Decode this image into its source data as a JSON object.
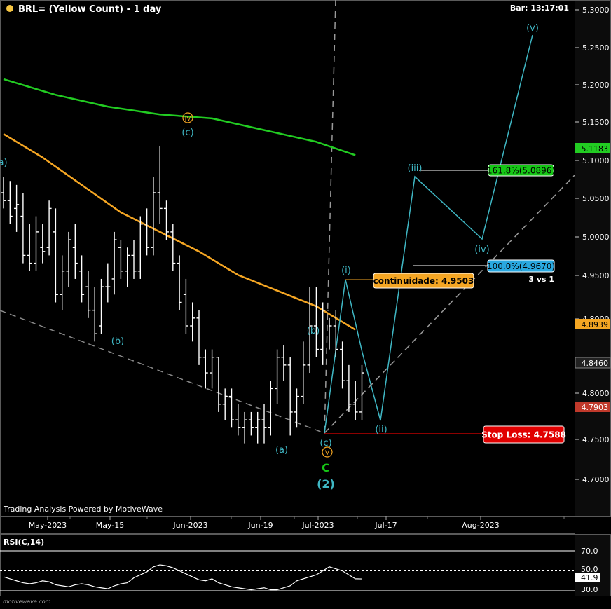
{
  "header": {
    "title": "BRL= (Yellow Count) - 1 day",
    "bar_time": "Bar: 13:17:01",
    "status_dot_color": "#f5c542"
  },
  "footer": {
    "credit": "Trading Analysis Powered by MotiveWave",
    "watermark": "motivewave.com"
  },
  "colors": {
    "ma_green": "#22cc22",
    "ma_orange": "#f5a623",
    "wave_cyan": "#3fb7c4",
    "bars": "#ffffff",
    "stop_loss": "#e00000",
    "fib_100": "#29a8e0",
    "fib_161": "#16c716",
    "continuidade": "#f5a623"
  },
  "chart_data": [
    {
      "type": "candlestick-ohlc",
      "title": "BRL= (Yellow Count) - 1 day",
      "x_tick_labels": [
        "May-2023",
        "May-15",
        "Jun-2023",
        "Jun-19",
        "Jul-2023",
        "Jul-17",
        "Aug-2023"
      ],
      "y_tick_labels": [
        "5.3000",
        "5.2500",
        "5.2000",
        "5.1500",
        "5.1000",
        "5.0500",
        "5.0000",
        "4.9500",
        "4.8000",
        "4.8460",
        "4.8000",
        "4.7500",
        "4.7000"
      ],
      "ylim": [
        4.65,
        5.32
      ],
      "price_tags": [
        {
          "label": "5.1183",
          "value": 5.1183,
          "color": "#22cc22"
        },
        {
          "label": "4.8939",
          "value": 4.8939,
          "color": "#f5a623"
        },
        {
          "label": "4.8460",
          "value": 4.846,
          "color": "#222222"
        },
        {
          "label": "4.7903",
          "value": 4.7903,
          "color": "#c0392b"
        }
      ],
      "series": [
        {
          "kind": "ohlc",
          "values": [
            [
              5.07,
              5.09,
              5.05,
              5.06
            ],
            [
              5.06,
              5.085,
              5.03,
              5.04
            ],
            [
              5.05,
              5.08,
              5.02,
              5.055
            ],
            [
              5.04,
              5.07,
              4.98,
              4.99
            ],
            [
              4.99,
              5.03,
              4.97,
              4.98
            ],
            [
              4.98,
              5.04,
              4.97,
              5.02
            ],
            [
              5.0,
              5.03,
              4.98,
              4.995
            ],
            [
              5.0,
              5.06,
              4.99,
              5.05
            ],
            [
              5.02,
              5.05,
              4.93,
              4.94
            ],
            [
              4.94,
              4.99,
              4.92,
              4.97
            ],
            [
              4.97,
              5.02,
              4.95,
              5.01
            ],
            [
              5.0,
              5.03,
              4.96,
              4.98
            ],
            [
              4.97,
              4.99,
              4.93,
              4.94
            ],
            [
              4.95,
              4.97,
              4.91,
              4.92
            ],
            [
              4.92,
              4.95,
              4.88,
              4.89
            ],
            [
              4.9,
              4.96,
              4.89,
              4.95
            ],
            [
              4.95,
              4.98,
              4.93,
              4.95
            ],
            [
              4.96,
              5.02,
              4.94,
              5.01
            ],
            [
              5.0,
              5.01,
              4.96,
              4.97
            ],
            [
              4.97,
              5.0,
              4.95,
              4.99
            ],
            [
              4.99,
              5.01,
              4.96,
              4.97
            ],
            [
              4.97,
              5.04,
              4.96,
              5.03
            ],
            [
              5.03,
              5.05,
              4.99,
              5.0
            ],
            [
              5.0,
              5.09,
              4.99,
              5.07
            ],
            [
              5.07,
              5.13,
              5.03,
              5.05
            ],
            [
              5.05,
              5.06,
              5.01,
              5.02
            ],
            [
              5.02,
              5.03,
              4.97,
              4.98
            ],
            [
              4.98,
              4.99,
              4.92,
              4.93
            ],
            [
              4.94,
              4.96,
              4.89,
              4.9
            ],
            [
              4.9,
              4.93,
              4.88,
              4.91
            ],
            [
              4.91,
              4.92,
              4.85,
              4.86
            ],
            [
              4.86,
              4.87,
              4.82,
              4.84
            ],
            [
              4.84,
              4.87,
              4.82,
              4.86
            ],
            [
              4.86,
              4.86,
              4.79,
              4.8
            ],
            [
              4.8,
              4.82,
              4.78,
              4.81
            ],
            [
              4.81,
              4.82,
              4.77,
              4.78
            ],
            [
              4.78,
              4.8,
              4.76,
              4.77
            ],
            [
              4.77,
              4.79,
              4.75,
              4.78
            ],
            [
              4.78,
              4.79,
              4.76,
              4.77
            ],
            [
              4.77,
              4.79,
              4.75,
              4.78
            ],
            [
              4.78,
              4.8,
              4.75,
              4.77
            ],
            [
              4.77,
              4.83,
              4.76,
              4.82
            ],
            [
              4.82,
              4.87,
              4.8,
              4.86
            ],
            [
              4.86,
              4.875,
              4.83,
              4.85
            ],
            [
              4.85,
              4.86,
              4.76,
              4.79
            ],
            [
              4.79,
              4.82,
              4.77,
              4.81
            ],
            [
              4.81,
              4.88,
              4.8,
              4.85
            ],
            [
              4.85,
              4.95,
              4.84,
              4.9
            ],
            [
              4.9,
              4.95,
              4.86,
              4.87
            ],
            [
              4.87,
              4.93,
              4.85,
              4.92
            ],
            [
              4.92,
              4.91,
              4.87,
              4.9
            ],
            [
              4.9,
              4.92,
              4.86,
              4.87
            ],
            [
              4.87,
              4.88,
              4.82,
              4.83
            ],
            [
              4.83,
              4.85,
              4.79,
              4.8
            ],
            [
              4.8,
              4.83,
              4.78,
              4.79
            ],
            [
              4.79,
              4.85,
              4.78,
              4.84
            ]
          ]
        },
        {
          "name": "",
          "kind": "moving-average",
          "color": "#22cc22",
          "x_index": [
            0,
            8,
            16,
            24,
            32,
            40,
            48,
            54
          ],
          "values": [
            5.215,
            5.195,
            5.18,
            5.17,
            5.165,
            5.15,
            5.135,
            5.118
          ]
        },
        {
          "name": "",
          "kind": "moving-average",
          "color": "#f5a623",
          "x_index": [
            0,
            6,
            12,
            18,
            24,
            30,
            36,
            42,
            48,
            54
          ],
          "values": [
            5.145,
            5.115,
            5.08,
            5.045,
            5.02,
            4.995,
            4.965,
            4.945,
            4.925,
            4.895
          ]
        }
      ],
      "wave_labels": [
        {
          "text": "a)",
          "color": "#3fb7c4"
        },
        {
          "text": "(b)",
          "color": "#3fb7c4"
        },
        {
          "text": "(c)",
          "color": "#3fb7c4"
        },
        {
          "text": "IV",
          "color": "#f5a623",
          "circled": true
        },
        {
          "text": "(a)",
          "color": "#3fb7c4"
        },
        {
          "text": "(b)",
          "color": "#3fb7c4"
        },
        {
          "text": "(c)",
          "color": "#3fb7c4"
        },
        {
          "text": "V",
          "color": "#f5a623",
          "circled": true
        },
        {
          "text": "C",
          "color": "#16c716"
        },
        {
          "text": "(2)",
          "color": "#3fb7c4"
        },
        {
          "text": "(i)",
          "color": "#3fb7c4"
        },
        {
          "text": "(ii)",
          "color": "#3fb7c4"
        },
        {
          "text": "(iii)",
          "color": "#3fb7c4"
        },
        {
          "text": "(iv)",
          "color": "#3fb7c4"
        },
        {
          "text": "(v)",
          "color": "#3fb7c4"
        }
      ],
      "projection": {
        "waves": [
          "(ii)",
          "(iii)",
          "(iv)",
          "(v)"
        ],
        "price_points": [
          4.78,
          5.083,
          5.0,
          5.27
        ]
      },
      "annotations": {
        "continuidade": "continuidade: 4.9503",
        "continuidade_value": 4.9503,
        "fib_100": "100.0%(4.9670)",
        "fib_100_value": 4.967,
        "fib_161": "161.8%(5.0896)",
        "fib_161_value": 5.0896,
        "ratio": "3 vs 1",
        "stop_loss": "Stop Loss: 4.7588",
        "stop_loss_value": 4.7588
      }
    },
    {
      "type": "line",
      "title": "RSI(C,14)",
      "ylim": [
        25,
        75
      ],
      "y_tick_labels": [
        "70.0",
        "50.0",
        "41.9",
        "30.0"
      ],
      "levels": [
        70,
        50,
        30
      ],
      "last_value_label": "41.9",
      "series": [
        {
          "name": "",
          "values": [
            44,
            42,
            40,
            38,
            37,
            38,
            40,
            39,
            36,
            35,
            34,
            36,
            37,
            36,
            34,
            33,
            32,
            35,
            37,
            38,
            43,
            46,
            49,
            54,
            56,
            55,
            53,
            50,
            47,
            44,
            41,
            40,
            42,
            38,
            36,
            34,
            33,
            32,
            31,
            32,
            33,
            31,
            31,
            33,
            35,
            40,
            42,
            44,
            46,
            50,
            54,
            52,
            50,
            46,
            42,
            41.9
          ]
        }
      ]
    }
  ]
}
